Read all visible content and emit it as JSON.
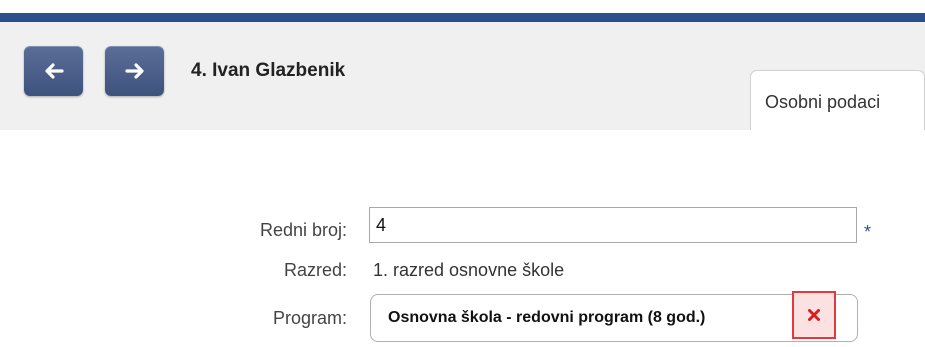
{
  "header": {
    "title": "4. Ivan Glazbenik",
    "back_icon": "arrow-left-icon",
    "forward_icon": "arrow-right-icon"
  },
  "tabs": [
    {
      "label": "Osobni podaci"
    }
  ],
  "form": {
    "redni_broj": {
      "label": "Redni broj:",
      "value": "4",
      "required_marker": "*"
    },
    "razred": {
      "label": "Razred:",
      "value": "1. razred osnovne škole"
    },
    "program": {
      "label": "Program:",
      "value": "Osnovna škola - redovni program (8 god.)",
      "clear_icon": "close-icon"
    }
  },
  "colors": {
    "header_stripe": "#2c4f8e",
    "nav_button": "#4a5e8a",
    "clear_border": "#e23a3a",
    "clear_background": "#fbe1e1"
  }
}
